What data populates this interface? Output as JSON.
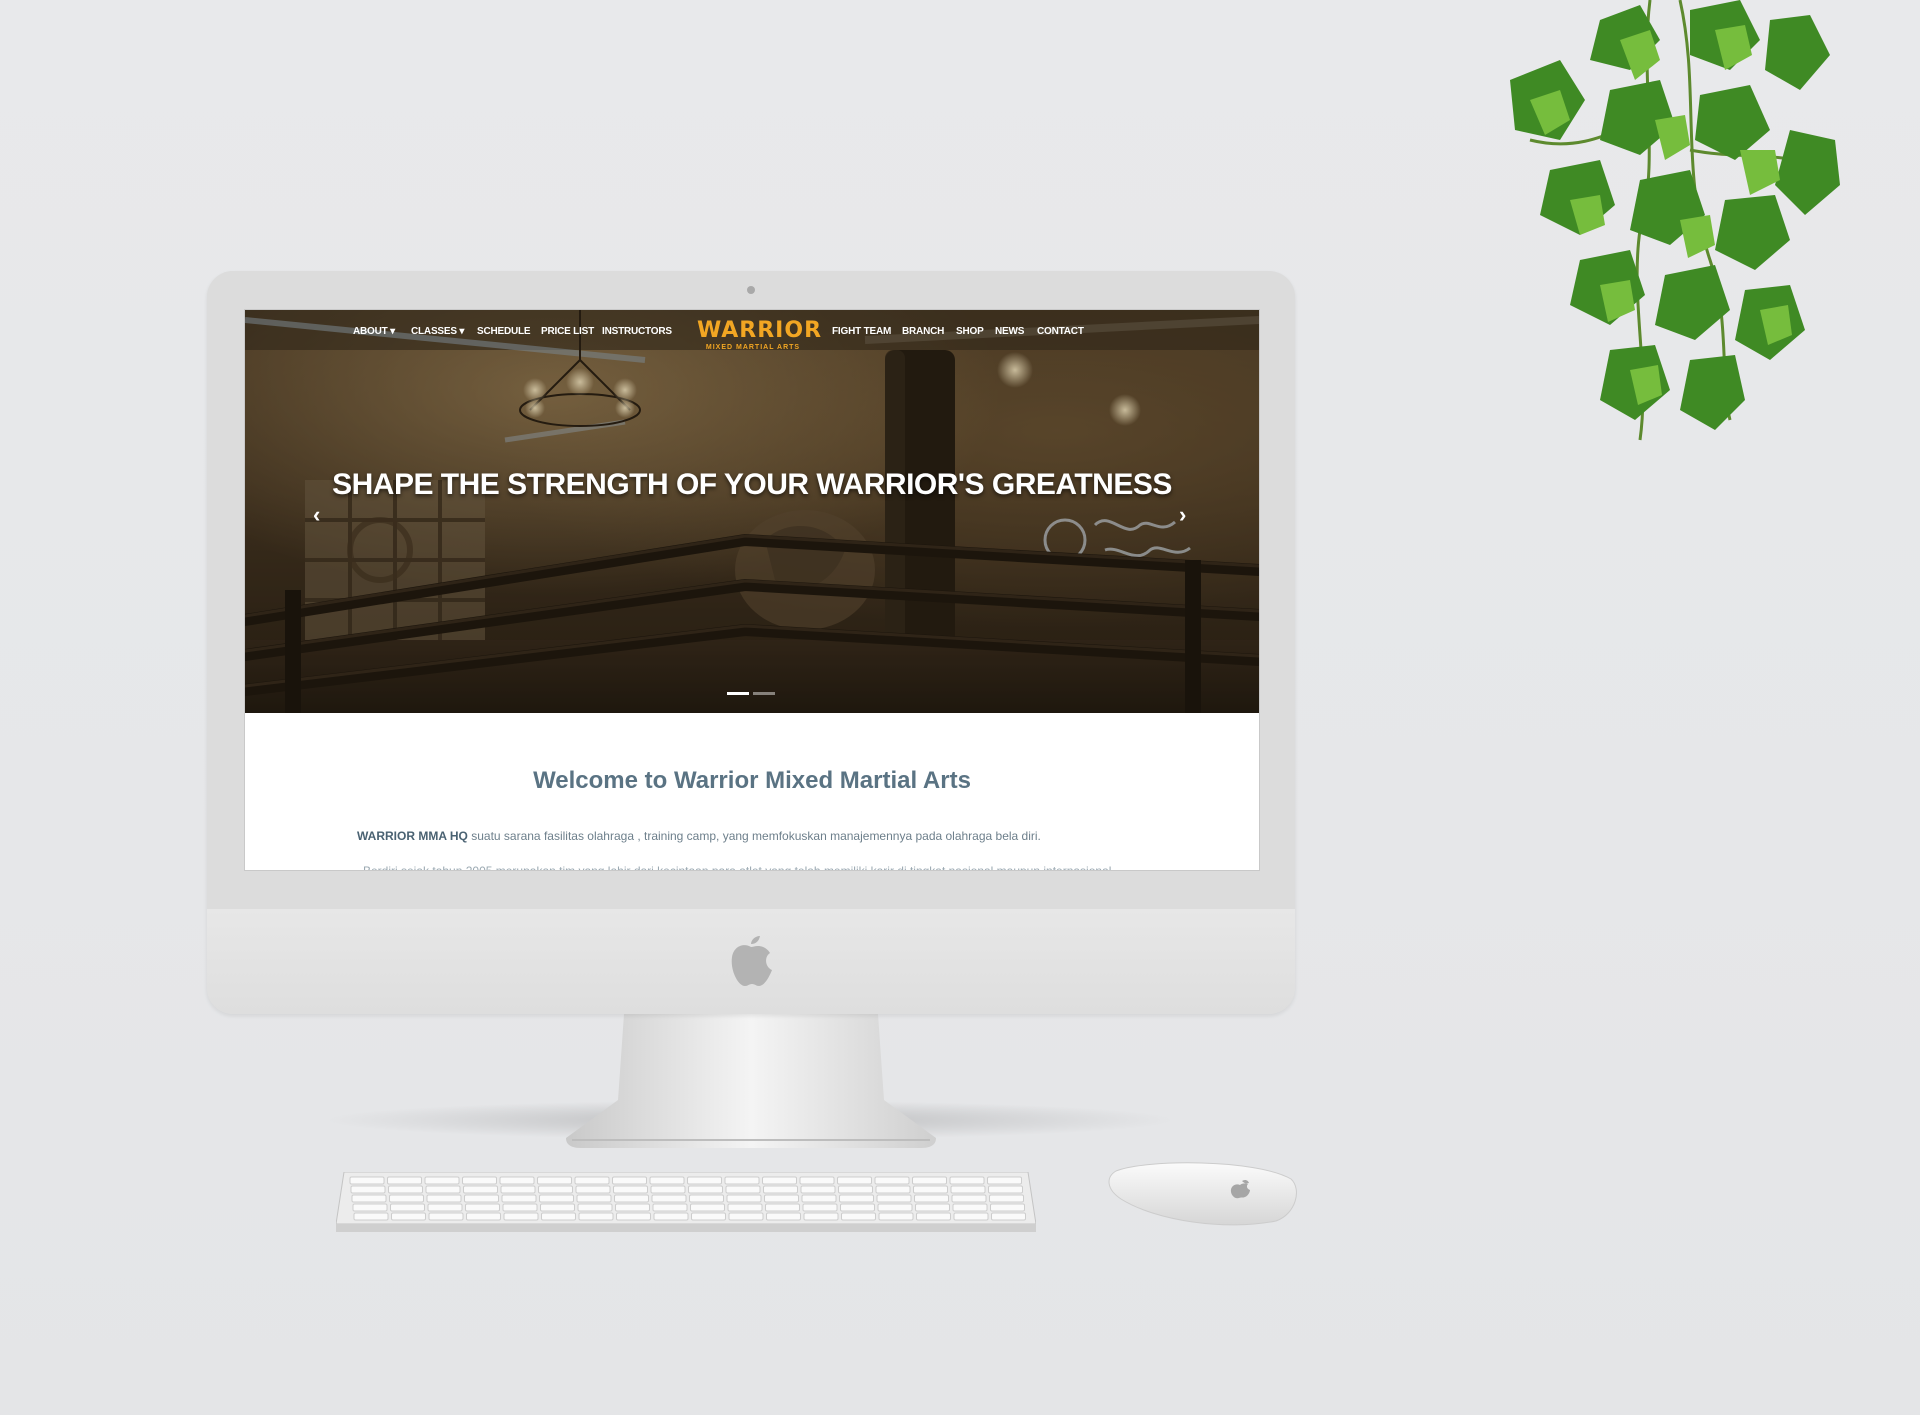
{
  "site": {
    "nav_left": [
      "ABOUT",
      "CLASSES",
      "SCHEDULE",
      "PRICE LIST",
      "INSTRUCTORS"
    ],
    "nav_right": [
      "FIGHT TEAM",
      "BRANCH",
      "SHOP",
      "NEWS",
      "CONTACT"
    ],
    "logo": {
      "word": "WARRIOR",
      "sub": "MIXED MARTIAL ARTS",
      "color": "#f2a623"
    },
    "hero": {
      "title": "SHAPE THE STRENGTH OF YOUR WARRIOR'S GREATNESS",
      "prev_icon": "chevron-left-icon",
      "next_icon": "chevron-right-icon",
      "slides": 2,
      "active_slide": 1
    },
    "welcome_title": "Welcome to Warrior Mixed Martial Arts",
    "intro_strong": "WARRIOR MMA HQ",
    "intro_rest": " suatu sarana fasilitas olahraga , training camp, yang memfokuskan manajemennya pada olahraga bela diri.",
    "intro_second_line": "Berdiri sejak tahun 2005 merupakan tim yang lahir dari kecintaan para atlet yang telah memiliki karir di tingkat nasional maupun internasional"
  },
  "colors": {
    "heading": "#5a7383",
    "accent": "#f2a623"
  }
}
